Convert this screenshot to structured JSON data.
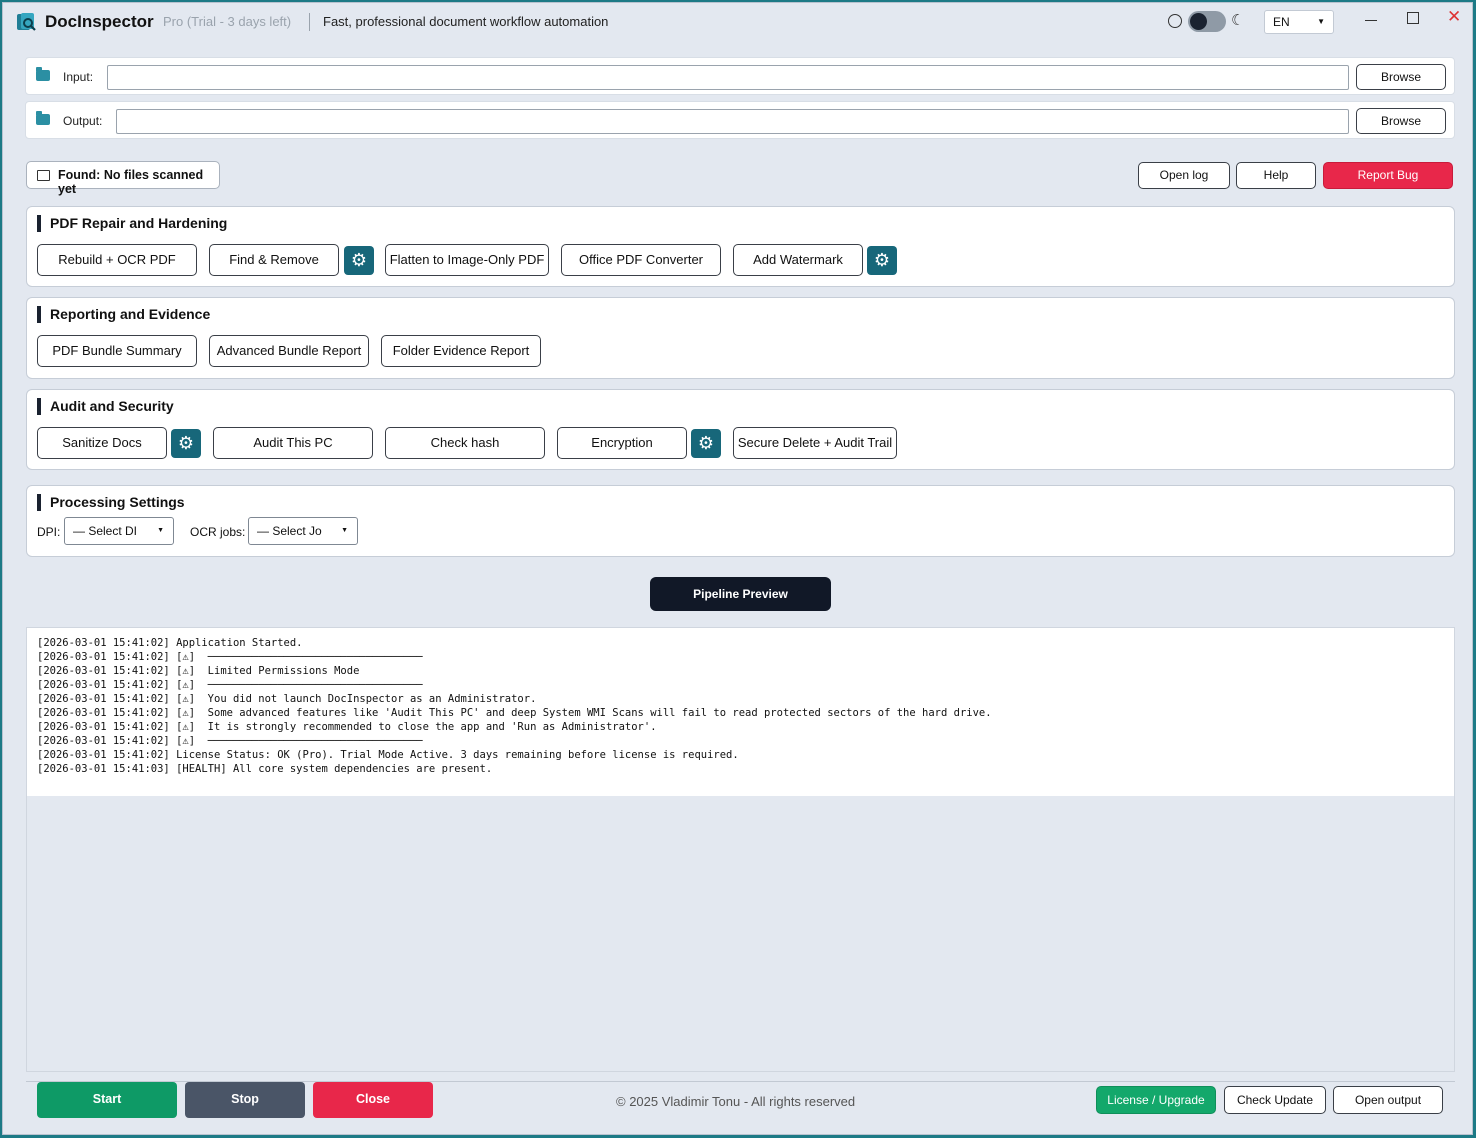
{
  "titlebar": {
    "app_name": "DocInspector",
    "edition": "Pro (Trial - 3 days left)",
    "tagline": "Fast, professional document workflow automation",
    "language": "EN",
    "window_close": "✕"
  },
  "paths": {
    "input_label": "Input:",
    "input_value": "",
    "output_label": "Output:",
    "output_value": "",
    "browse_label": "Browse"
  },
  "status": {
    "found_text": "Found: No files scanned yet"
  },
  "top_actions": {
    "open_log": "Open log",
    "help": "Help",
    "report_bug": "Report Bug"
  },
  "sections": {
    "pdf_repair": {
      "title": "PDF Repair and Hardening",
      "buttons": [
        "Rebuild + OCR PDF",
        "Find & Remove",
        "Flatten to Image-Only PDF",
        "Office PDF Converter",
        "Add Watermark"
      ]
    },
    "reporting": {
      "title": "Reporting and Evidence",
      "buttons": [
        "PDF Bundle Summary",
        "Advanced Bundle Report",
        "Folder Evidence Report"
      ]
    },
    "audit": {
      "title": "Audit and Security",
      "buttons": [
        "Sanitize Docs",
        "Audit This PC",
        "Check hash",
        "Encryption",
        "Secure Delete + Audit Trail"
      ]
    },
    "processing": {
      "title": "Processing Settings",
      "dpi_label": "DPI:",
      "dpi_value": "— Select DI",
      "ocr_label": "OCR jobs:",
      "ocr_value": "— Select Jo"
    }
  },
  "pipeline_preview": "Pipeline Preview",
  "log": [
    "[2026-03-01 15:41:02] Application Started.",
    "[2026-03-01 15:41:02] [⚠]  ──────────────────────────────────",
    "[2026-03-01 15:41:02] [⚠]  Limited Permissions Mode",
    "[2026-03-01 15:41:02] [⚠]  ──────────────────────────────────",
    "[2026-03-01 15:41:02] [⚠]  You did not launch DocInspector as an Administrator.",
    "[2026-03-01 15:41:02] [⚠]  Some advanced features like 'Audit This PC' and deep System WMI Scans will fail to read protected sectors of the hard drive.",
    "[2026-03-01 15:41:02] [⚠]  It is strongly recommended to close the app and 'Run as Administrator'.",
    "[2026-03-01 15:41:02] [⚠]  ──────────────────────────────────",
    "[2026-03-01 15:41:02] License Status: OK (Pro). Trial Mode Active. 3 days remaining before license is required.",
    "[2026-03-01 15:41:03] [HEALTH] All core system dependencies are present."
  ],
  "footer": {
    "start": "Start",
    "stop": "Stop",
    "close": "Close",
    "copyright": "© 2025 Vladimir Tonu - All rights reserved",
    "license": "License / Upgrade",
    "check_update": "Check Update",
    "open_output": "Open output"
  },
  "colors": {
    "accent_teal": "#17677a",
    "danger": "#e8274a",
    "success": "#13a86b",
    "dark": "#111827",
    "stop_gray": "#4a5567",
    "start_green": "#0e9a66"
  },
  "icons": {
    "logo": "app-logo-icon",
    "theme_light": "sun-icon",
    "theme_dark": "moon-icon",
    "folder": "folder-icon",
    "settings": "gear-icon"
  }
}
